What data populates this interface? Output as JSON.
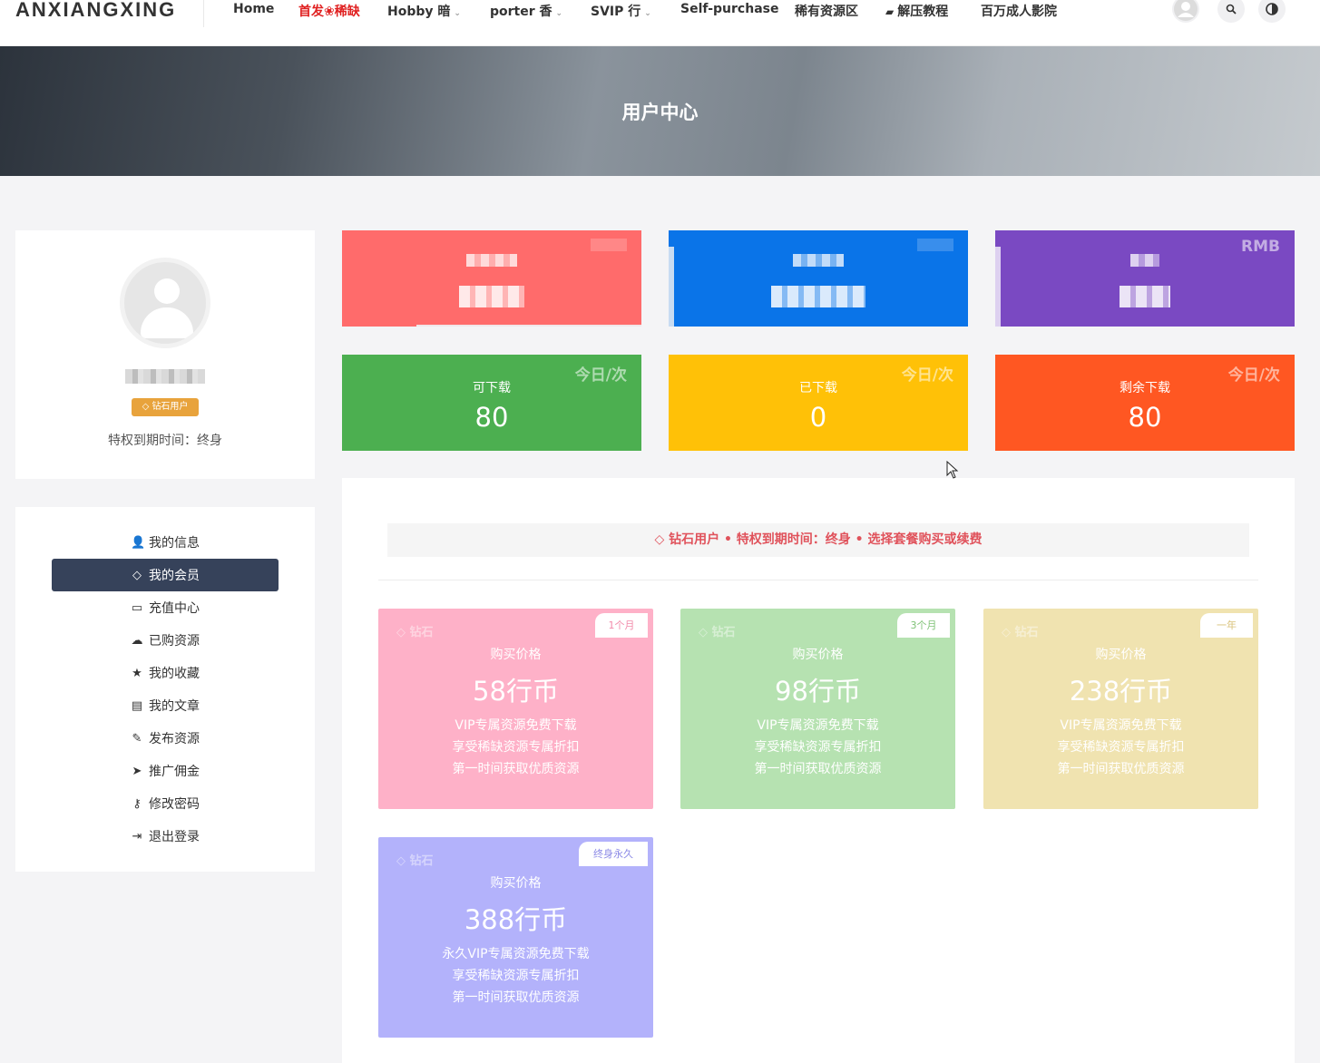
{
  "header": {
    "logo": "ANXIANGXING",
    "nav": [
      {
        "label": "Home",
        "dropdown": false,
        "red": false
      },
      {
        "label": "首发❀稀缺",
        "dropdown": false,
        "red": true
      },
      {
        "label": "Hobby 暗",
        "dropdown": true,
        "red": false
      },
      {
        "label": "porter 香",
        "dropdown": true,
        "red": false
      },
      {
        "label": "SVIP 行",
        "dropdown": true,
        "red": false
      },
      {
        "label": "Self-purchase",
        "dropdown": false,
        "red": false
      },
      {
        "label": "稀有资源区",
        "dropdown": false,
        "red": false
      },
      {
        "label": "解压教程",
        "dropdown": false,
        "red": false
      },
      {
        "label": "百万成人影院",
        "dropdown": false,
        "red": false
      }
    ]
  },
  "banner": {
    "title": "用户中心"
  },
  "profile": {
    "badge": "钻石用户",
    "expire": "特权到期时间：终身"
  },
  "menu": [
    {
      "label": "我的信息",
      "icon": "user-icon",
      "glyph": "👤",
      "active": false
    },
    {
      "label": "我的会员",
      "icon": "diamond-icon",
      "glyph": "◇",
      "active": true
    },
    {
      "label": "充值中心",
      "icon": "credit-card-icon",
      "glyph": "▭",
      "active": false
    },
    {
      "label": "已购资源",
      "icon": "cloud-download-icon",
      "glyph": "☁",
      "active": false
    },
    {
      "label": "我的收藏",
      "icon": "star-icon",
      "glyph": "★",
      "active": false
    },
    {
      "label": "我的文章",
      "icon": "file-icon",
      "glyph": "▤",
      "active": false
    },
    {
      "label": "发布资源",
      "icon": "pencil-icon",
      "glyph": "✎",
      "active": false
    },
    {
      "label": "推广佣金",
      "icon": "paper-plane-icon",
      "glyph": "➤",
      "active": false
    },
    {
      "label": "修改密码",
      "icon": "key-icon",
      "glyph": "⚷",
      "active": false
    },
    {
      "label": "退出登录",
      "icon": "sign-out-icon",
      "glyph": "⇥",
      "active": false
    }
  ],
  "stats_top": [
    {
      "corner": "",
      "color": "#ff6b6b"
    },
    {
      "corner": "",
      "color": "#0a74e8"
    },
    {
      "corner": "RMB",
      "color": "#7a49c2"
    }
  ],
  "stats_bottom": [
    {
      "corner": "今日/次",
      "label": "可下载",
      "value": "80",
      "color": "#4caf50"
    },
    {
      "corner": "今日/次",
      "label": "已下载",
      "value": "0",
      "color": "#ffc107"
    },
    {
      "corner": "今日/次",
      "label": "剩余下载",
      "value": "80",
      "color": "#ff5722"
    }
  ],
  "notice": "◇ 钻石用户 • 特权到期时间：终身 • 选择套餐购买或续费",
  "plans": [
    {
      "gem": "◇ 钻石",
      "tag": "1个月",
      "label": "购买价格",
      "price": "58行币",
      "color": "#feb1c8",
      "tag_color": "#f28cab",
      "features": [
        "VIP专属资源免费下载",
        "享受稀缺资源专属折扣",
        "第一时间获取优质资源"
      ]
    },
    {
      "gem": "◇ 钻石",
      "tag": "3个月",
      "label": "购买价格",
      "price": "98行币",
      "color": "#b6e2b1",
      "tag_color": "#7fc276",
      "features": [
        "VIP专属资源免费下载",
        "享受稀缺资源专属折扣",
        "第一时间获取优质资源"
      ]
    },
    {
      "gem": "◇ 钻石",
      "tag": "一年",
      "label": "购买价格",
      "price": "238行币",
      "color": "#f0e3b0",
      "tag_color": "#d9c27a",
      "features": [
        "VIP专属资源免费下载",
        "享受稀缺资源专属折扣",
        "第一时间获取优质资源"
      ]
    },
    {
      "gem": "◇ 钻石",
      "tag": "终身永久",
      "label": "购买价格",
      "price": "388行币",
      "color": "#b3b2fb",
      "tag_color": "#8b89e6",
      "features": [
        "永久VIP专属资源免费下载",
        "享受稀缺资源专属折扣",
        "第一时间获取优质资源"
      ]
    }
  ]
}
